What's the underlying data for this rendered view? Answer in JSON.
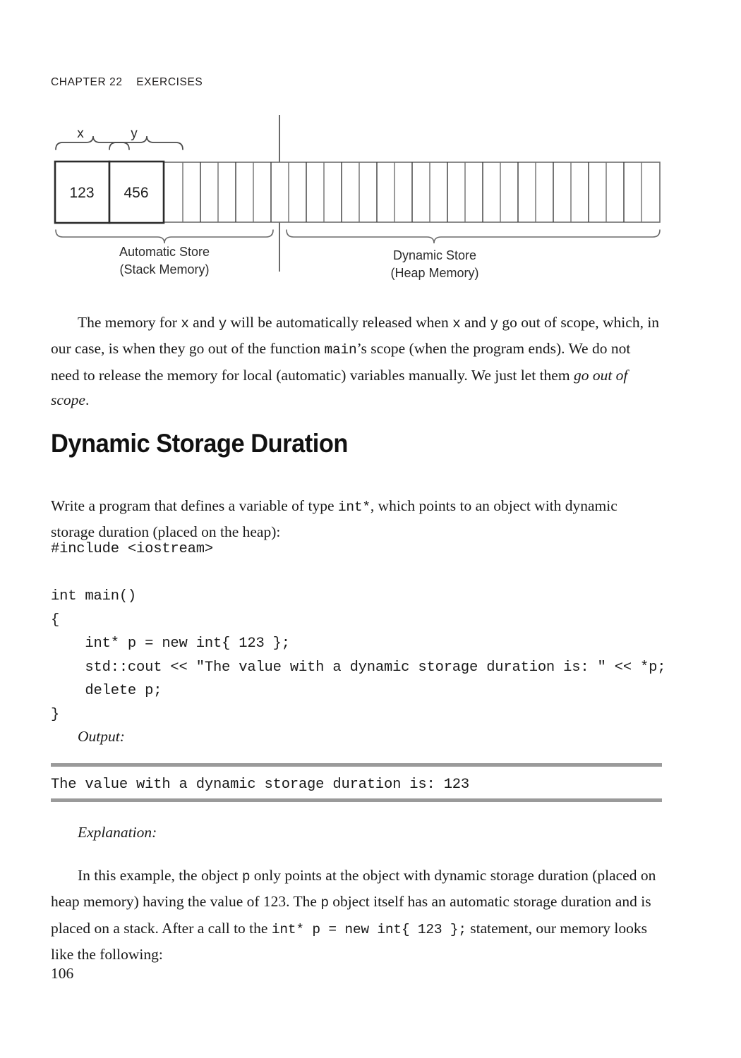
{
  "running_head": "CHAPTER 22    EXERCISES",
  "folio": "106",
  "diagram": {
    "name": "memory-layout-diagram",
    "cells": [
      {
        "label": "x",
        "value": "123"
      },
      {
        "label": "y",
        "value": "456"
      }
    ],
    "regions": [
      {
        "title": "Automatic Store",
        "subtitle": "(Stack Memory)"
      },
      {
        "title": "Dynamic Store",
        "subtitle": "(Heap Memory)"
      }
    ]
  },
  "paragraphs": {
    "intro": {
      "p1_a": "The memory for ",
      "p1_x": "x",
      "p1_b": " and ",
      "p1_y": "y",
      "p1_c": " will be automatically released when ",
      "p1_x2": "x",
      "p1_d": " and ",
      "p1_y2": "y",
      "p1_e": " go out of scope, which, in our case, is when they go out of the function ",
      "p1_main": "main",
      "p1_f": "’s scope (when the program ends). We do not need to release the memory for local (automatic) variables manually. We just let them ",
      "p1_ital": "go out of scope",
      "p1_g": "."
    },
    "prompt": {
      "a": "Write a program that defines a variable of type ",
      "code": "int*",
      "b": ", which points to an object with dynamic storage duration (placed on the heap):"
    },
    "explanation": {
      "a": "In this example, the object ",
      "code1": "p",
      "b": " only points at the object with dynamic storage duration (placed on heap memory) having the value of 123. The ",
      "code2": "p",
      "c": " object itself has an automatic storage duration and is placed on a stack. After a call to the ",
      "code3": "int* p = new int{ 123 };",
      "d": " statement, our memory looks like the following:"
    }
  },
  "section_heading": "Dynamic Storage Duration",
  "code_block": "#include <iostream>\n\nint main()\n{\n    int* p = new int{ 123 };\n    std::cout << \"The value with a dynamic storage duration is: \" << *p;\n    delete p;\n}",
  "output_label": "Output:",
  "output_text": "The value with a dynamic storage duration is: 123",
  "explanation_label": "Explanation:",
  "colors": {
    "rule": "#9a9a9a",
    "text": "#191919",
    "diagram_stroke": "#4a4a4a",
    "cell_stroke": "#2b2b2b"
  }
}
